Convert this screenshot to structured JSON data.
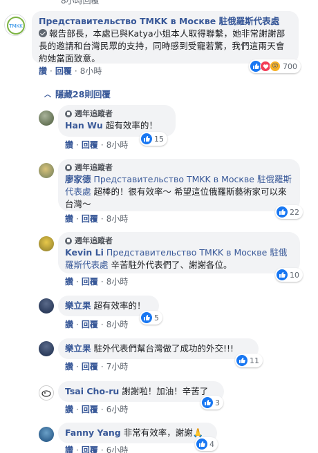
{
  "top_partial": {
    "label": "8小時回覆"
  },
  "post_comment": {
    "name": "Представительство TMKK в Москве 駐俄羅斯代表處",
    "text": "報告部長，本處已與Katya小姐本人取得聯繫，她非常謝謝部長的邀請和台灣民眾的支持，同時感到受寵若驚，我們這兩天會約她當面致意。",
    "reactions": "700",
    "actions": {
      "like": "讚",
      "reply": "回覆",
      "time": "8小時"
    }
  },
  "hidden_replies": {
    "label": "隱藏28則回覆"
  },
  "replies": [
    {
      "badge": "週年追蹤者",
      "name": "Han Wu",
      "mention": "",
      "text": "超有效率的！",
      "reactions": "15",
      "actions": {
        "like": "讚",
        "reply": "回覆",
        "time": "8小時"
      }
    },
    {
      "badge": "週年追蹤者",
      "name": "廖家德",
      "mention": "Представительство TMKK в Москве 駐俄羅斯代表處",
      "text": "超棒的！很有效率～ 希望這位俄羅斯藝術家可以來台灣～",
      "reactions": "22",
      "actions": {
        "like": "讚",
        "reply": "回覆",
        "time": "8小時"
      }
    },
    {
      "badge": "週年追蹤者",
      "name": "Kevin Li",
      "mention": "Представительство TMKK в Москве 駐俄羅斯代表處",
      "text": "辛苦駐外代表們了、謝謝各位。",
      "reactions": "10",
      "actions": {
        "like": "讚",
        "reply": "回覆",
        "time": "8小時"
      }
    },
    {
      "badge": "",
      "name": "樂立果",
      "mention": "",
      "text": "超有效率的！",
      "reactions": "5",
      "actions": {
        "like": "讚",
        "reply": "回覆",
        "time": "8小時"
      }
    },
    {
      "badge": "",
      "name": "樂立果",
      "mention": "",
      "text": "駐外代表們幫台灣做了成功的外交!!!",
      "reactions": "11",
      "actions": {
        "like": "讚",
        "reply": "回覆",
        "time": "7小時"
      }
    },
    {
      "badge": "",
      "name": "Tsai Cho-ru",
      "mention": "",
      "text": "謝謝啦！加油！辛苦了",
      "reactions": "3",
      "actions": {
        "like": "讚",
        "reply": "回覆",
        "time": "6小時"
      }
    },
    {
      "badge": "",
      "name": "Fanny Yang",
      "mention": "",
      "text": "非常有效率，謝謝🙏",
      "reactions": "4",
      "actions": {
        "like": "讚",
        "reply": "回覆",
        "time": "6小時"
      }
    }
  ],
  "colors": {
    "link": "#385898",
    "bubble": "#f2f3f5",
    "like": "#1877f2"
  }
}
